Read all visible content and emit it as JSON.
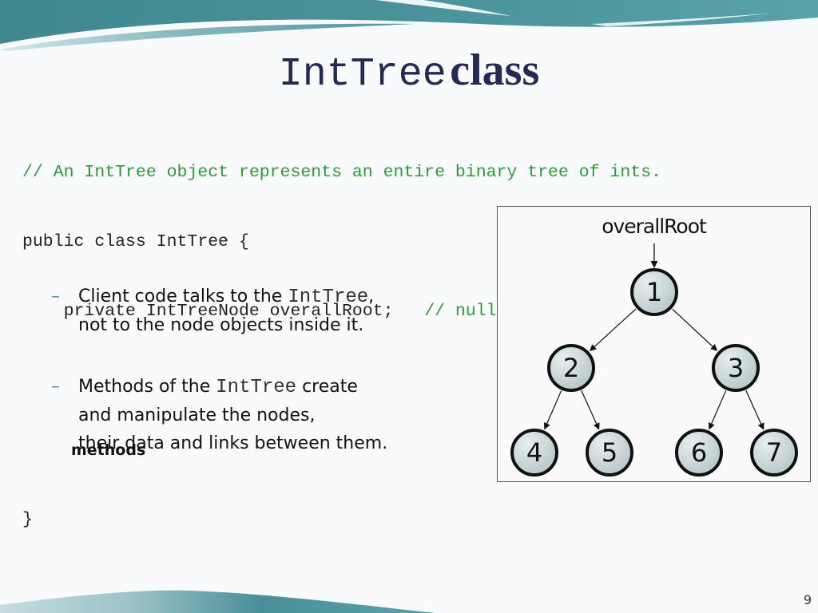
{
  "slide": {
    "title_code": "IntTree",
    "title_text": "class",
    "page_number": "9"
  },
  "code": {
    "line1": "// An IntTree object represents an entire binary tree of ints.",
    "line2": "public class IntTree {",
    "line3_code": "    private IntTreeNode overallRoot;   ",
    "line3_comment": "// null for an empty tree",
    "methods_label": "methods",
    "closing_brace": "}"
  },
  "bullets": [
    {
      "dash": "–",
      "before": "Client code talks to the ",
      "code": "IntTree",
      "after": ",",
      "line2": "not to the node objects inside it."
    },
    {
      "dash": "–",
      "before": "Methods of the ",
      "code": "IntTree",
      "after": " create",
      "line2": "and manipulate the nodes,",
      "line3": "their data and links between them."
    }
  ],
  "tree": {
    "root_label": "overallRoot",
    "nodes": [
      {
        "id": "1",
        "value": "1",
        "parent": null,
        "level": 0,
        "index": 0
      },
      {
        "id": "2",
        "value": "2",
        "parent": "1",
        "level": 1,
        "index": 0
      },
      {
        "id": "3",
        "value": "3",
        "parent": "1",
        "level": 1,
        "index": 1
      },
      {
        "id": "4",
        "value": "4",
        "parent": "2",
        "level": 2,
        "index": 0
      },
      {
        "id": "5",
        "value": "5",
        "parent": "2",
        "level": 2,
        "index": 1
      },
      {
        "id": "6",
        "value": "6",
        "parent": "3",
        "level": 2,
        "index": 2
      },
      {
        "id": "7",
        "value": "7",
        "parent": "3",
        "level": 2,
        "index": 3
      }
    ],
    "colors": {
      "node_fill_light": "#e6eef0",
      "node_fill_dark": "#b4c4c6",
      "node_stroke": "#111111"
    }
  },
  "theme": {
    "accent_teal": "#4f969e",
    "comment_green": "#2f9a3a",
    "title_navy": "#252a52",
    "bullet_blue": "#4a8fc4"
  }
}
